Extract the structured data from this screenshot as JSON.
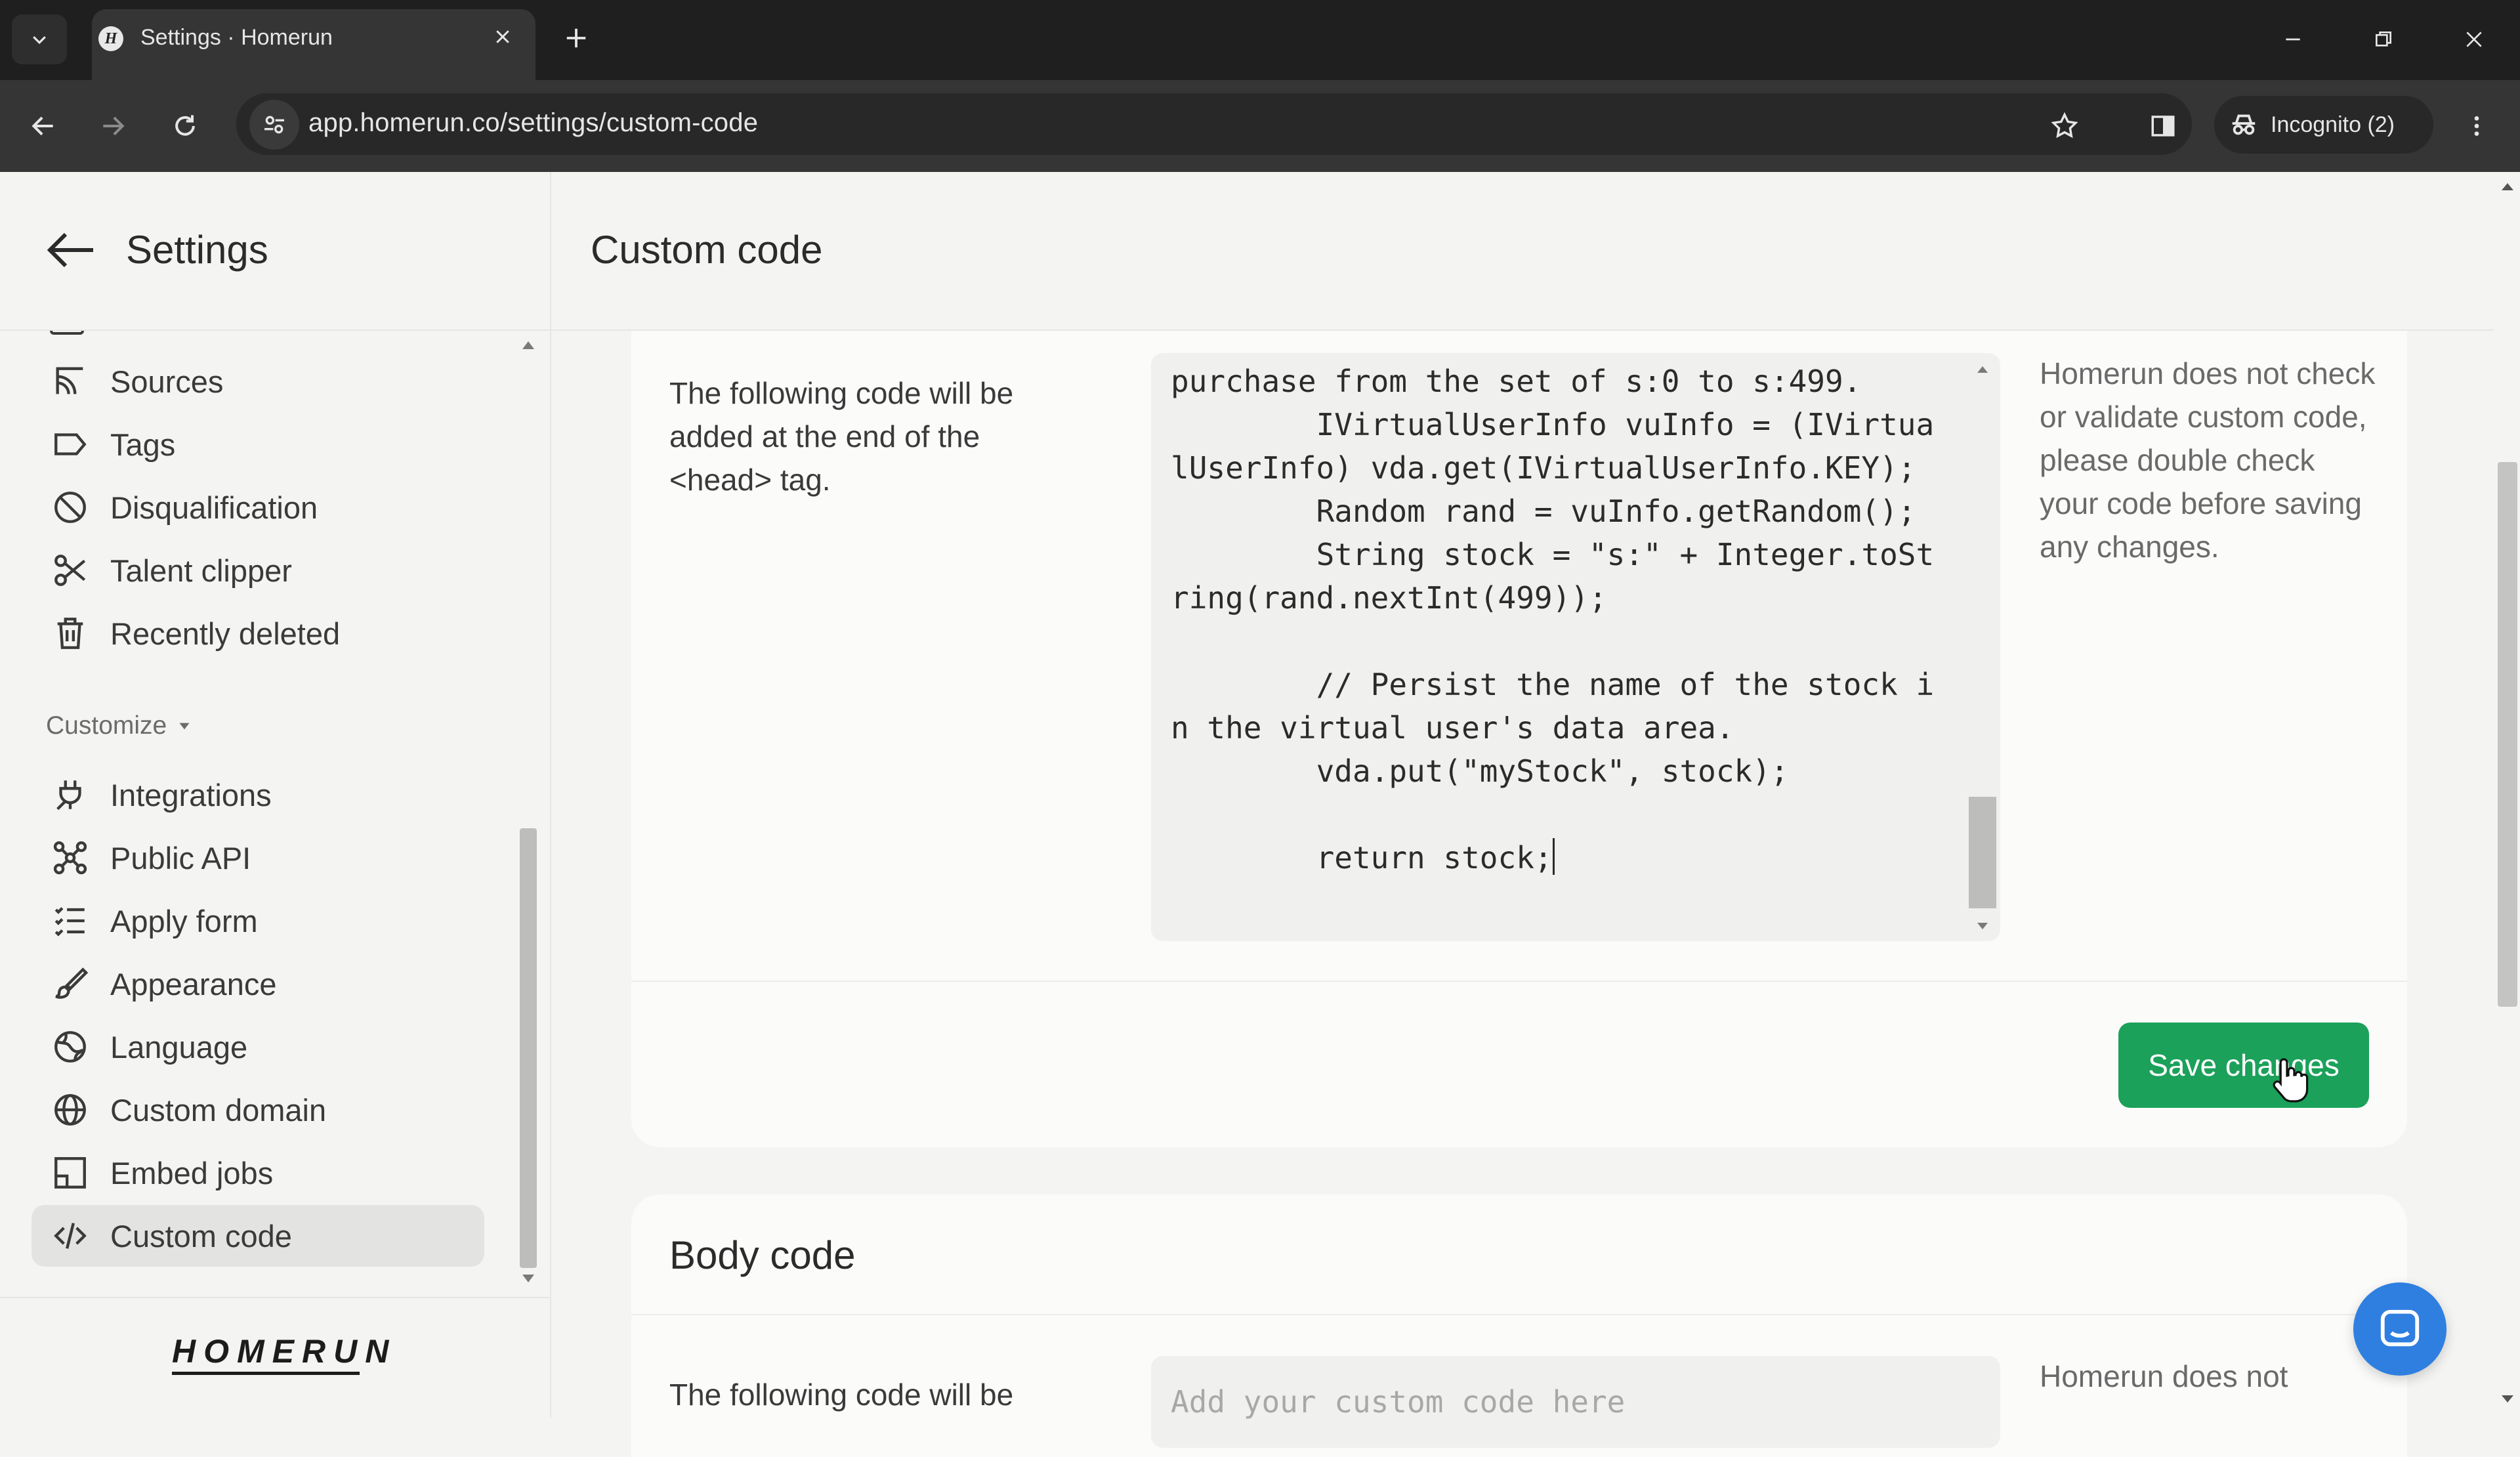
{
  "browser": {
    "tab_title": "Settings · Homerun",
    "tab_favicon": "H",
    "url": "app.homerun.co/settings/custom-code",
    "incognito_label": "Incognito (2)"
  },
  "sidebar": {
    "title": "Settings",
    "items_top": [
      {
        "label": "Sources",
        "icon": "sources-icon"
      },
      {
        "label": "Tags",
        "icon": "tag-icon"
      },
      {
        "label": "Disqualification",
        "icon": "ban-icon"
      },
      {
        "label": "Talent clipper",
        "icon": "scissors-icon"
      },
      {
        "label": "Recently deleted",
        "icon": "trash-icon"
      }
    ],
    "section_label": "Customize",
    "items_customize": [
      {
        "label": "Integrations",
        "icon": "plug-icon"
      },
      {
        "label": "Public API",
        "icon": "api-icon"
      },
      {
        "label": "Apply form",
        "icon": "list-icon"
      },
      {
        "label": "Appearance",
        "icon": "brush-icon"
      },
      {
        "label": "Language",
        "icon": "language-icon"
      },
      {
        "label": "Custom domain",
        "icon": "globe-icon"
      },
      {
        "label": "Embed jobs",
        "icon": "embed-icon"
      },
      {
        "label": "Custom code",
        "icon": "code-icon"
      }
    ],
    "logo_text": "HOMERUN"
  },
  "main": {
    "title": "Custom code",
    "head_section": {
      "description": "The following code will be added at the end of the <head> tag.",
      "code": "purchase from the set of s:0 to s:499.\n        IVirtualUserInfo vuInfo = (IVirtualUserInfo) vda.get(IVirtualUserInfo.KEY);\n        Random rand = vuInfo.getRandom();\n        String stock = \"s:\" + Integer.toString(rand.nextInt(499));\n\n        // Persist the name of the stock in the virtual user's data area.\n        vda.put(\"myStock\", stock);\n\n        return stock;",
      "note": "Homerun does not check or validate custom code, please double check your code before saving any changes.",
      "save_label": "Save changes"
    },
    "body_section": {
      "title": "Body code",
      "description": "The following code will be",
      "placeholder": "Add your custom code here",
      "note": "Homerun does not"
    }
  },
  "colors": {
    "accent_green": "#1ba15a",
    "chat_blue": "#2f7fe0"
  }
}
